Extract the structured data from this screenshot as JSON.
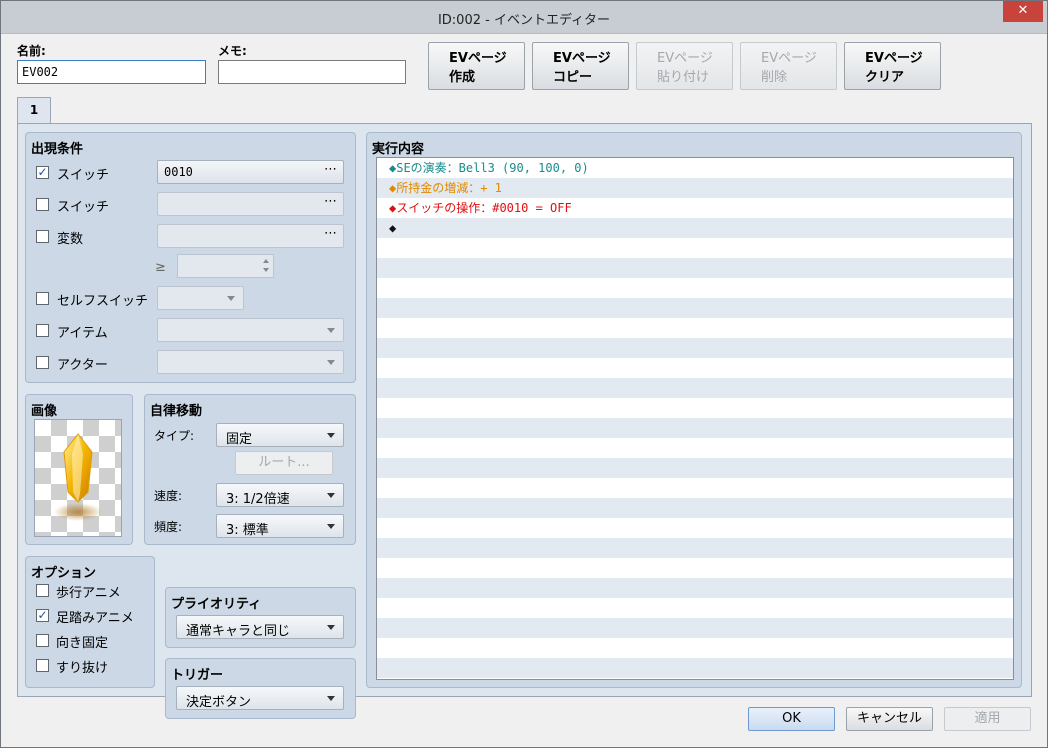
{
  "window": {
    "title": "ID:002 - イベントエディター",
    "close": "✕"
  },
  "name": {
    "label": "名前:",
    "value": "EV002"
  },
  "memo": {
    "label": "メモ:",
    "value": ""
  },
  "toolbar": [
    {
      "line1": "EVページ",
      "line2": "作成",
      "enabled": true
    },
    {
      "line1": "EVページ",
      "line2": "コピー",
      "enabled": true
    },
    {
      "line1": "EVページ",
      "line2": "貼り付け",
      "enabled": false
    },
    {
      "line1": "EVページ",
      "line2": "削除",
      "enabled": false
    },
    {
      "line1": "EVページ",
      "line2": "クリア",
      "enabled": true
    }
  ],
  "tab": {
    "label": "1"
  },
  "conditions": {
    "title": "出現条件",
    "switch1": {
      "label": "スイッチ",
      "checked": true,
      "value": "0010"
    },
    "switch2": {
      "label": "スイッチ",
      "checked": false,
      "value": ""
    },
    "variable": {
      "label": "変数",
      "checked": false,
      "value": "",
      "op": "≥"
    },
    "self_switch": {
      "label": "セルフスイッチ",
      "checked": false,
      "value": ""
    },
    "item": {
      "label": "アイテム",
      "checked": false,
      "value": ""
    },
    "actor": {
      "label": "アクター",
      "checked": false,
      "value": ""
    },
    "dots": "⋯"
  },
  "image": {
    "title": "画像"
  },
  "autonomous": {
    "title": "自律移動",
    "type_label": "タイプ:",
    "type_value": "固定",
    "route_button": "ルート...",
    "speed_label": "速度:",
    "speed_value": "3: 1/2倍速",
    "freq_label": "頻度:",
    "freq_value": "3: 標準"
  },
  "options": {
    "title": "オプション",
    "items": [
      {
        "label": "歩行アニメ",
        "checked": false
      },
      {
        "label": "足踏みアニメ",
        "checked": true
      },
      {
        "label": "向き固定",
        "checked": false
      },
      {
        "label": "すり抜け",
        "checked": false
      }
    ]
  },
  "priority": {
    "title": "プライオリティ",
    "value": "通常キャラと同じ"
  },
  "trigger": {
    "title": "トリガー",
    "value": "決定ボタン"
  },
  "contents": {
    "title": "実行内容",
    "lines": [
      {
        "text": "◆SEの演奏：Bell3 (90, 100, 0)",
        "color": "#1a8c8c"
      },
      {
        "text": "◆所持金の増減：+ 1",
        "color": "#e08a00"
      },
      {
        "text": "◆スイッチの操作：#0010 = OFF",
        "color": "#e01010"
      },
      {
        "text": "◆",
        "color": "#111111"
      }
    ]
  },
  "footer": {
    "ok": "OK",
    "cancel": "キャンセル",
    "apply": "適用"
  }
}
